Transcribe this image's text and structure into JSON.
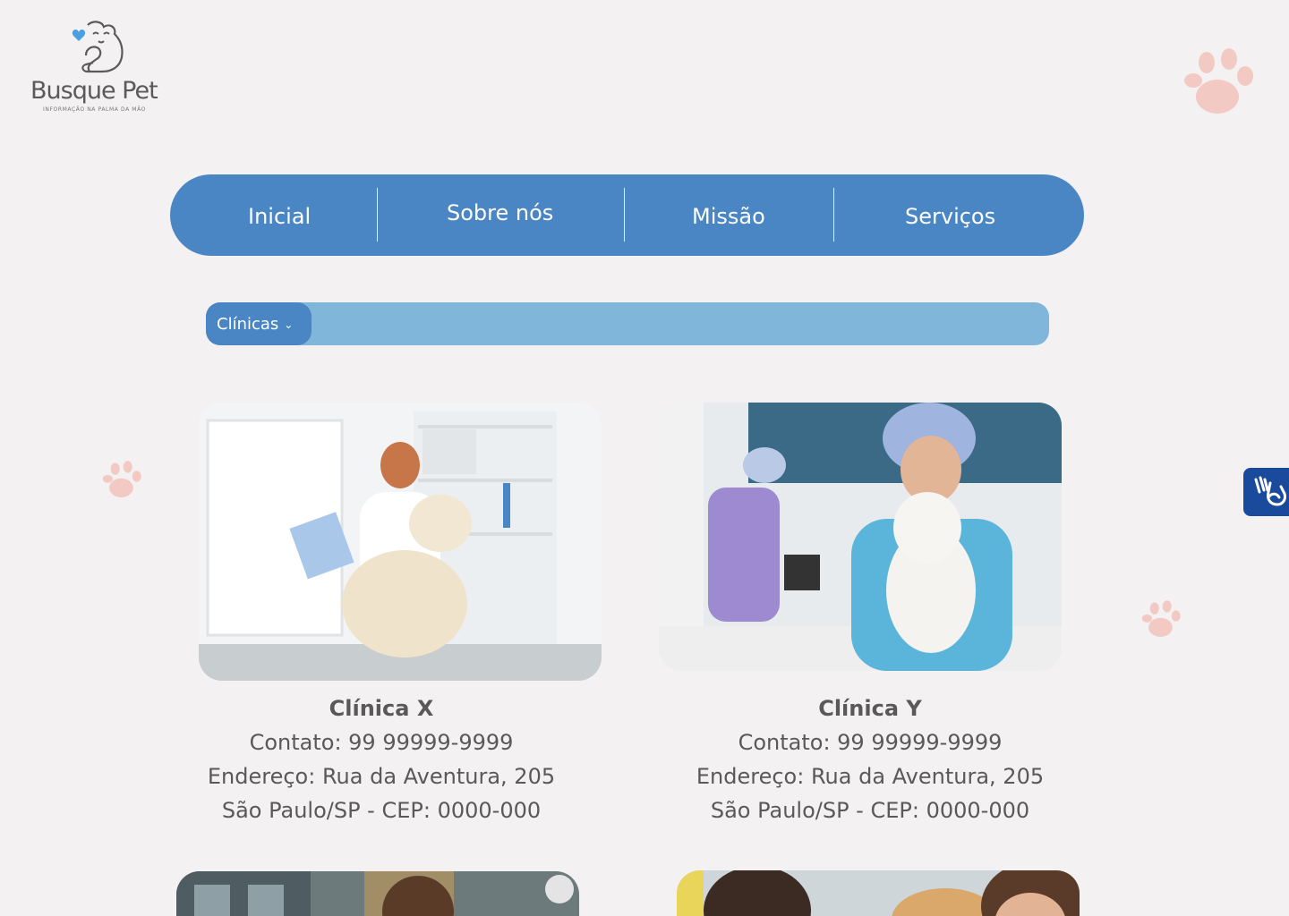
{
  "brand": {
    "name": "Busque Pet",
    "tagline": "INFORMAÇÃO NA PALMA DA MÃO",
    "heart_color": "#4a9fe0"
  },
  "nav": {
    "items": [
      {
        "label": "Inicial"
      },
      {
        "label": "Sobre nós"
      },
      {
        "label": "Missão"
      },
      {
        "label": "Serviços"
      }
    ],
    "color": "#4a86c3"
  },
  "filter": {
    "selected": "Clínicas",
    "bar_color": "#7fb6d9"
  },
  "clinics": [
    {
      "name": "Clínica X",
      "contact": "Contato: 99 99999-9999",
      "address": "Endereço: Rua da Aventura, 205",
      "city": "São Paulo/SP - CEP: 0000-000"
    },
    {
      "name": "Clínica Y",
      "contact": "Contato: 99 99999-9999",
      "address": "Endereço: Rua da Aventura, 205",
      "city": "São Paulo/SP - CEP: 0000-000"
    }
  ],
  "icons": {
    "paw": "paw-icon",
    "accessibility": "sign-language-icon",
    "dropdown": "chevron-down-icon"
  }
}
